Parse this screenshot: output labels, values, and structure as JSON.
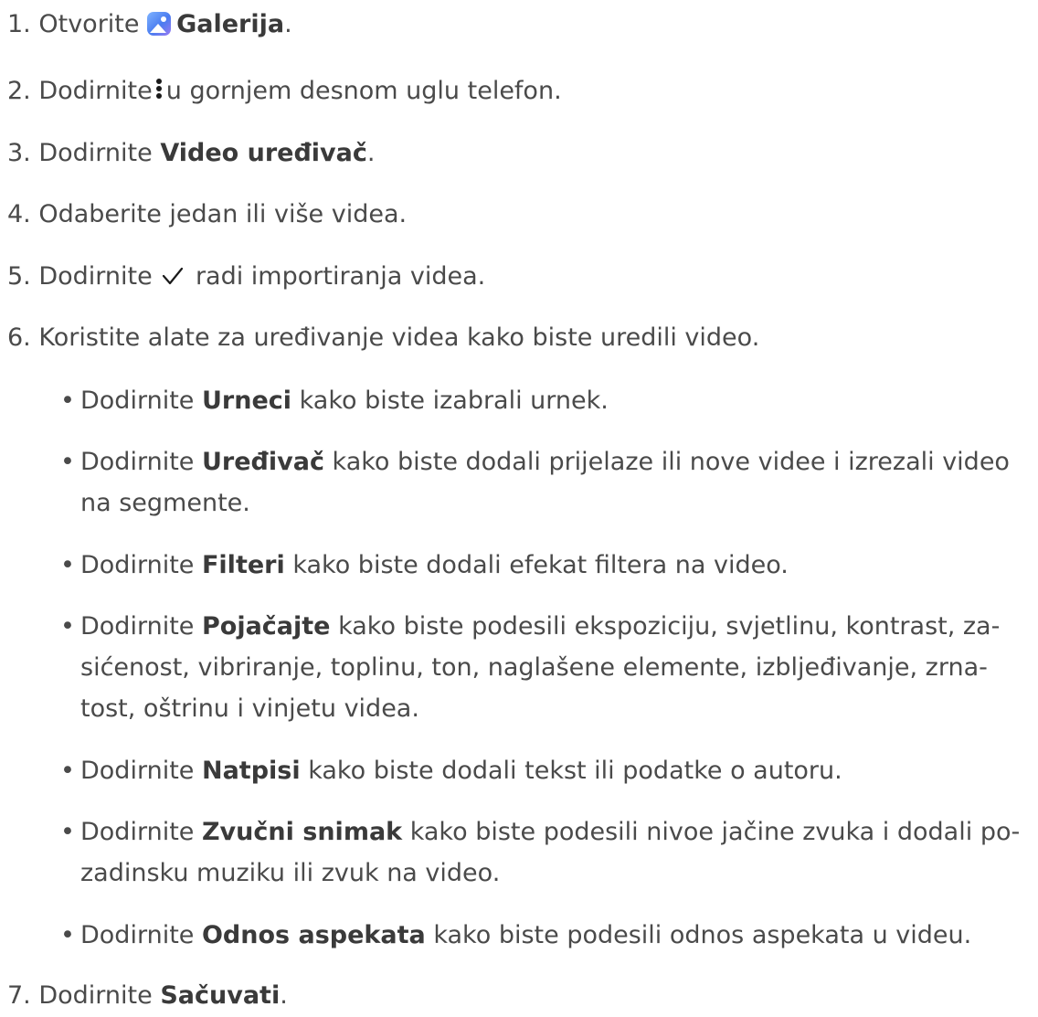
{
  "steps": [
    {
      "num": "1.",
      "pre": "Otvorite",
      "icon": "gallery-icon",
      "bold": "Galerija",
      "post": "."
    },
    {
      "num": "2.",
      "pre": "Dodirnite",
      "icon": "more-vertical-icon",
      "post": "u gornjem desnom uglu telefon."
    },
    {
      "num": "3.",
      "pre": "Dodirnite",
      "bold": "Video uređivač",
      "post": "."
    },
    {
      "num": "4.",
      "text": "Odaberite jedan ili više videa."
    },
    {
      "num": "5.",
      "pre": "Dodirnite",
      "icon": "checkmark-icon",
      "post": "radi importiranja videa."
    },
    {
      "num": "6.",
      "text": "Koristite alate za uređivanje videa kako biste uredili video."
    },
    {
      "num": "7.",
      "pre": "Dodirnite",
      "bold": "Sačuvati",
      "post": "."
    }
  ],
  "bullets": [
    {
      "pre": "Dodirnite",
      "bold": "Urneci",
      "post": "kako biste izabrali urnek."
    },
    {
      "pre": "Dodirnite",
      "bold": "Uređivač",
      "post": "kako biste dodali prijelaze ili nove videe i izrezali video na segmente."
    },
    {
      "pre": "Dodirnite",
      "bold": "Filteri",
      "post": "kako biste dodali efekat filtera na video."
    },
    {
      "pre": "Dodirnite",
      "bold": "Pojačajte",
      "post": "kako biste podesili ekspoziciju, svjetlinu, kontrast, za­sićenost, vibriranje, toplinu, ton, naglašene elemente, izbljeđivanje, zrna­tost, oštrinu i vinjetu videa."
    },
    {
      "pre": "Dodirnite",
      "bold": "Natpisi",
      "post": "kako biste dodali tekst ili podatke o autoru."
    },
    {
      "pre": "Dodirnite",
      "bold": "Zvučni snimak",
      "post": "kako biste podesili nivoe jačine zvuka i dodali po­zadinsku muziku ili zvuk na video."
    },
    {
      "pre": "Dodirnite",
      "bold": "Odnos aspekata",
      "post": "kako biste podesili odnos aspekata u videu."
    }
  ],
  "bullet_glyph": "•"
}
